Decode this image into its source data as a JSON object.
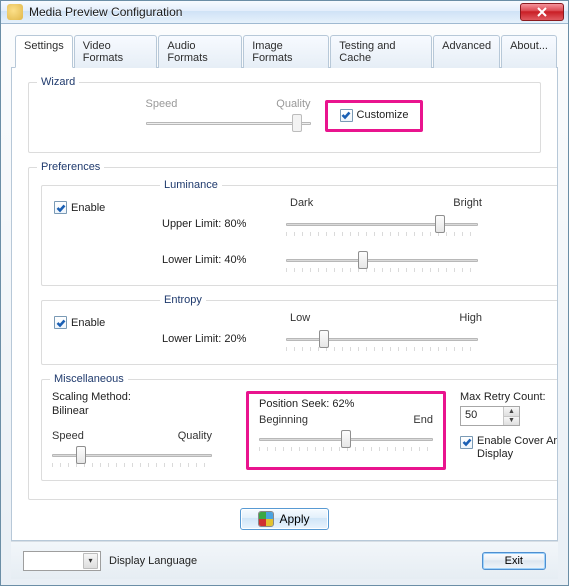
{
  "window": {
    "title": "Media Preview Configuration"
  },
  "tabs": [
    {
      "label": "Settings"
    },
    {
      "label": "Video Formats"
    },
    {
      "label": "Audio Formats"
    },
    {
      "label": "Image Formats"
    },
    {
      "label": "Testing and Cache"
    },
    {
      "label": "Advanced"
    },
    {
      "label": "About..."
    }
  ],
  "wizard": {
    "group": "Wizard",
    "speed": "Speed",
    "quality": "Quality",
    "customize_label": "Customize",
    "customize_checked": true,
    "slider_pos_pct": 92
  },
  "prefs": {
    "group": "Preferences",
    "luminance": {
      "group": "Luminance",
      "enable": "Enable",
      "enable_checked": true,
      "dark": "Dark",
      "bright": "Bright",
      "upper": {
        "label": "Upper Limit: 80%",
        "pos_pct": 80
      },
      "lower": {
        "label": "Lower Limit: 40%",
        "pos_pct": 40
      }
    },
    "entropy": {
      "group": "Entropy",
      "enable": "Enable",
      "enable_checked": true,
      "low": "Low",
      "high": "High",
      "lower": {
        "label": "Lower Limit: 20%",
        "pos_pct": 20
      }
    },
    "misc": {
      "group": "Miscellaneous",
      "scaling_method": "Scaling Method:\nBilinear",
      "speed": "Speed",
      "quality": "Quality",
      "scaling_slider_pos_pct": 18,
      "position_seek": "Position Seek: 62%",
      "beginning": "Beginning",
      "end": "End",
      "seek_slider_pos_pct": 50,
      "max_retry": "Max Retry Count:",
      "max_retry_value": "50",
      "cover_art": "Enable Cover Art\nDisplay",
      "cover_art_checked": true
    }
  },
  "apply": "Apply",
  "footer": {
    "display_language": "Display Language",
    "exit": "Exit"
  }
}
